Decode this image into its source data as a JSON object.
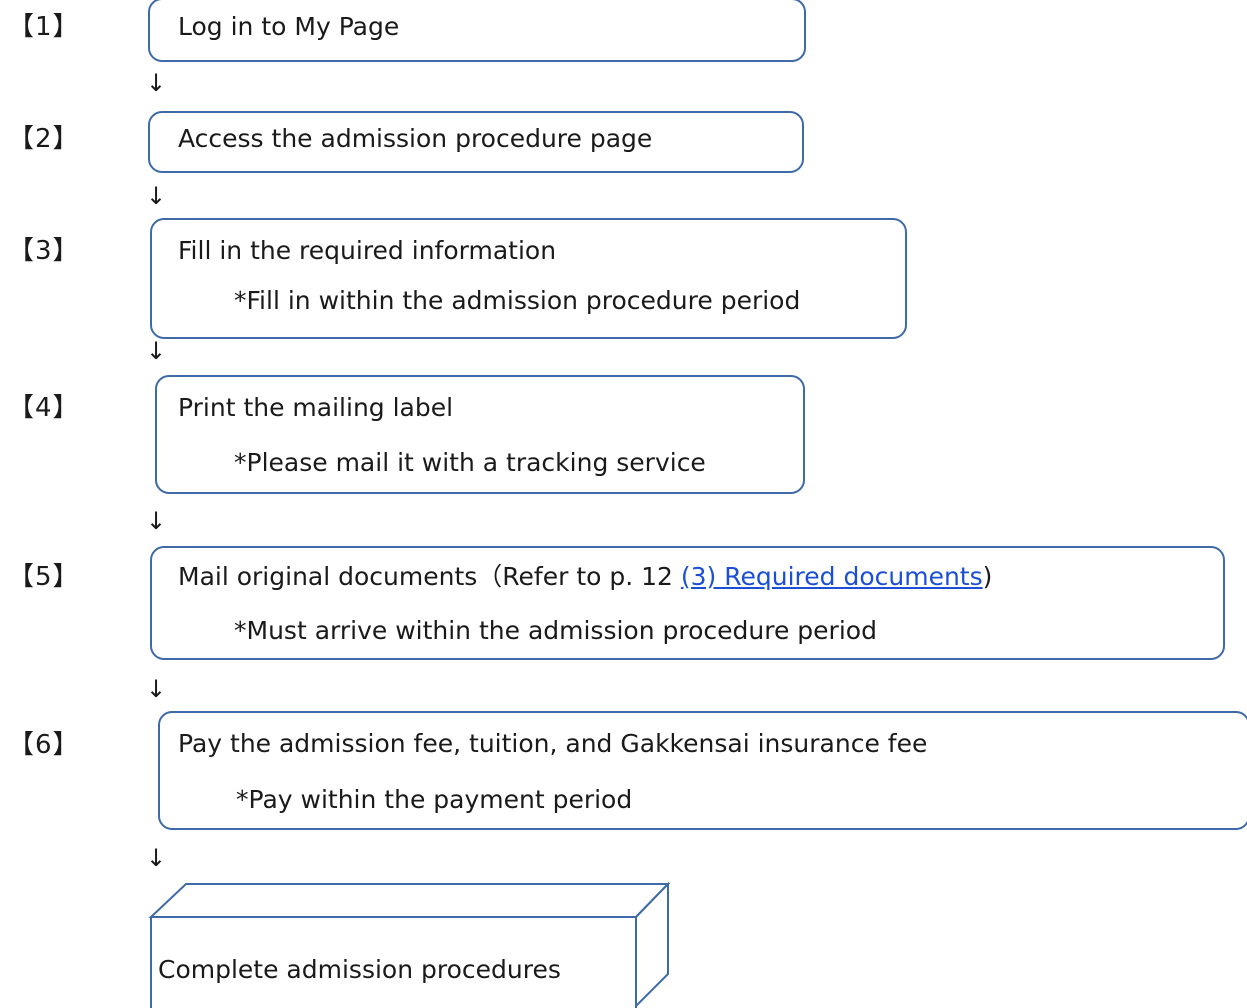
{
  "steps": [
    {
      "number": "【1】",
      "title": "Log in to My Page"
    },
    {
      "number": "【2】",
      "title": "Access the admission procedure page"
    },
    {
      "number": "【3】",
      "title": "Fill in the required information",
      "note": "*Fill in within the admission procedure period"
    },
    {
      "number": "【4】",
      "title": "Print the mailing label",
      "note": "*Please mail it with a tracking service"
    },
    {
      "number": "【5】",
      "title_prefix": "Mail original documents（Refer to p. 12 ",
      "link_text": "(3) Required documents",
      "title_suffix": ")",
      "note": "*Must arrive within the admission procedure period"
    },
    {
      "number": "【6】",
      "title": "Pay the admission fee, tuition, and Gakkensai insurance fee",
      "note": "*Pay within the payment period"
    }
  ],
  "arrow_glyph": "↓",
  "final_step": {
    "label": "Complete admission procedures"
  },
  "colors": {
    "box_border": "#3e6aa8",
    "link": "#1a4fd6",
    "text": "#1a1a1a"
  }
}
